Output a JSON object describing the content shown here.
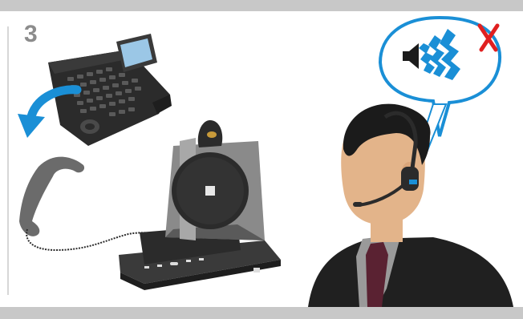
{
  "step": {
    "number": "3"
  },
  "colors": {
    "frame_band": "#c8c8c8",
    "step_number": "#8c8c8c",
    "arrow": "#1a8fd6",
    "bubble_stroke": "#1a8fd6",
    "speaker_wave": "#1a8fd6",
    "cross": "#e02020",
    "skin": "#e3b48a",
    "hair": "#1b1b1b",
    "suit": "#202020",
    "tie": "#5a2232",
    "shirt": "#9a9a9a",
    "device_dark": "#2b2b2b",
    "device_gray": "#8a8a8a",
    "receiver": "#6b6b6b"
  },
  "icons": [
    "desk-phone-icon",
    "handset-icon",
    "base-station-icon",
    "headset-icon",
    "speaker-icon",
    "sound-wave-icon",
    "error-cross-icon",
    "user-figure-icon"
  ]
}
